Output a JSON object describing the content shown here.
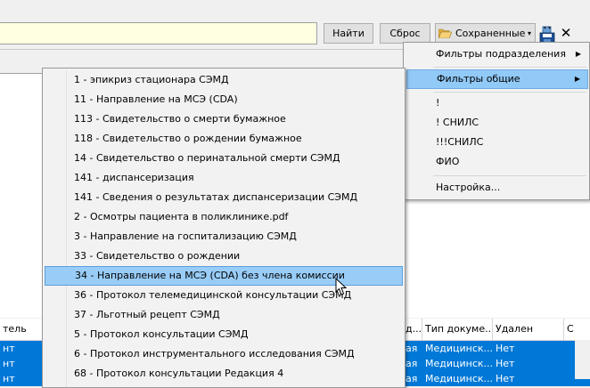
{
  "toolbar": {
    "search_value": "",
    "find_label": "Найти",
    "reset_label": "Сброс",
    "saved_label": "Сохраненные",
    "saved_arrow": "▾",
    "close_glyph": "✕"
  },
  "saved_menu": {
    "items": [
      {
        "label": "Фильтры подразделения",
        "submenu": "▶"
      },
      {
        "label": "Фильтры общие",
        "submenu": "▶"
      },
      {
        "label": "!"
      },
      {
        "label": "! СНИЛС"
      },
      {
        "label": "!!!СНИЛС"
      },
      {
        "label": "ФИО"
      },
      {
        "label": "Настройка..."
      }
    ]
  },
  "doc_menu": {
    "items": [
      {
        "label": "1 - эпикриз стационара СЭМД"
      },
      {
        "label": "11 - Направление на МСЭ (CDA)"
      },
      {
        "label": "113 - Свидетельство о смерти бумажное"
      },
      {
        "label": "118 - Свидетельство о рождении бумажное"
      },
      {
        "label": "14 - Свидетельство о перинатальной смерти СЭМД"
      },
      {
        "label": "141 - диспансеризация"
      },
      {
        "label": "141 - Сведения о результатах диспансеризации СЭМД"
      },
      {
        "label": "2 - Осмотры пациента в поликлинике.pdf"
      },
      {
        "label": "3 - Направление на госпитализацию СЭМД"
      },
      {
        "label": "33 - Свидетельство о рождении"
      },
      {
        "label": "34 - Направление на МСЭ (CDA) без члена комиссии"
      },
      {
        "label": "36 - Протокол телемедицинской консультации СЭМД"
      },
      {
        "label": "37 - Льготный рецепт СЭМД"
      },
      {
        "label": "5 - Протокол консультации СЭМД"
      },
      {
        "label": "6 - Протокол инструментального исследования СЭМД"
      },
      {
        "label": "68 - Протокол консультации Редакция 4"
      }
    ]
  },
  "grid": {
    "headers": [
      "тель",
      "д...",
      "Тип докуме...",
      "Удален",
      "С"
    ],
    "rows": [
      {
        "c0": "нт",
        "c1": "ая",
        "type": "Медицинск...",
        "deleted": "Нет"
      },
      {
        "c0": "нт",
        "c1": "ая",
        "type": "Медицинск...",
        "deleted": "Нет"
      },
      {
        "c0": "нт",
        "c1": "ая",
        "type": "Медицинск...",
        "deleted": "Нет"
      }
    ]
  },
  "colors": {
    "accent": "#0078d7",
    "menu_highlight": "#99cdf8",
    "search_bg": "#ffffe1"
  }
}
